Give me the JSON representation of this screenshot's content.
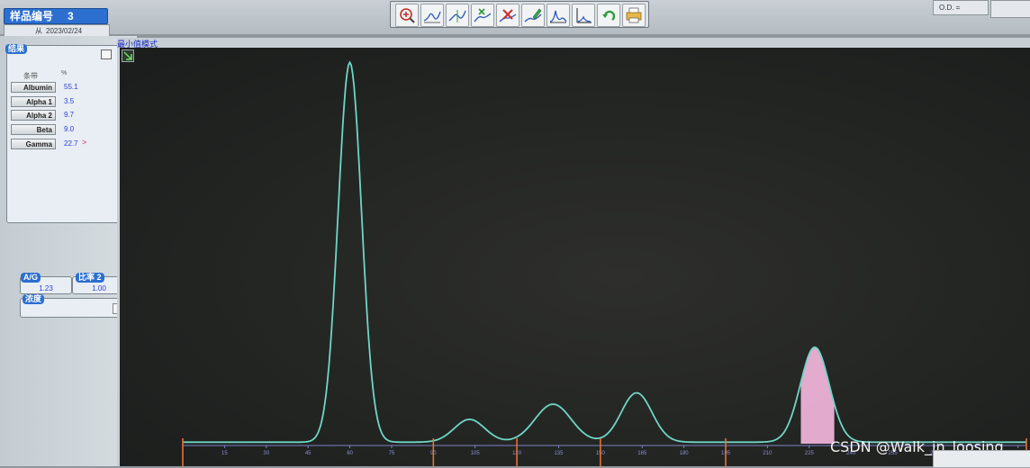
{
  "header": {
    "sample_label": "样品编号",
    "sample_number": "3",
    "date_prefix": "从",
    "date": "2023/02/24",
    "od_label": "O.D. ="
  },
  "toolbar": {
    "buttons": [
      {
        "name": "zoom-in-icon"
      },
      {
        "name": "curve-icon"
      },
      {
        "name": "curve-split-icon"
      },
      {
        "name": "add-point-icon"
      },
      {
        "name": "delete-point-icon"
      },
      {
        "name": "edit-curve-icon"
      },
      {
        "name": "peak-icon"
      },
      {
        "name": "baseline-icon"
      },
      {
        "name": "undo-icon"
      },
      {
        "name": "print-icon"
      }
    ]
  },
  "results": {
    "title": "结果",
    "col_fraction": "条带",
    "col_percent": "%",
    "fractions": [
      {
        "name": "Albumin",
        "value": "55.1",
        "flag": ""
      },
      {
        "name": "Alpha 1",
        "value": "3.5",
        "flag": ""
      },
      {
        "name": "Alpha 2",
        "value": "9.7",
        "flag": ""
      },
      {
        "name": "Beta",
        "value": "9.0",
        "flag": ""
      },
      {
        "name": "Gamma",
        "value": "22.7",
        "flag": ">"
      }
    ]
  },
  "ratios": {
    "ag_label": "A/G",
    "ag_value": "1.23",
    "ratio2_label": "比率 2",
    "ratio2_value": "1.00",
    "concentration_label": "浓度"
  },
  "chart": {
    "mode_label": "最小值模式",
    "curve_color": "#6fd6c4",
    "highlight_color": "#f3b6dc",
    "split_marker_color": "#e8702e"
  },
  "chart_data": {
    "type": "line",
    "title": "",
    "x_ticks": [
      "15",
      "30",
      "45",
      "60",
      "75",
      "90",
      "105",
      "120",
      "135",
      "150",
      "165",
      "180",
      "195",
      "210",
      "225",
      "240",
      "255",
      "270",
      "285",
      "300"
    ],
    "split_positions": [
      90,
      120,
      150,
      195
    ],
    "peaks": [
      {
        "x": 60,
        "height": 1.0
      },
      {
        "x": 103,
        "height": 0.06
      },
      {
        "x": 133,
        "height": 0.1
      },
      {
        "x": 163,
        "height": 0.13
      },
      {
        "x": 227,
        "height": 0.25
      }
    ],
    "highlight_range": [
      222,
      234
    ]
  },
  "watermark": "CSDN @Walk_in_loosing"
}
